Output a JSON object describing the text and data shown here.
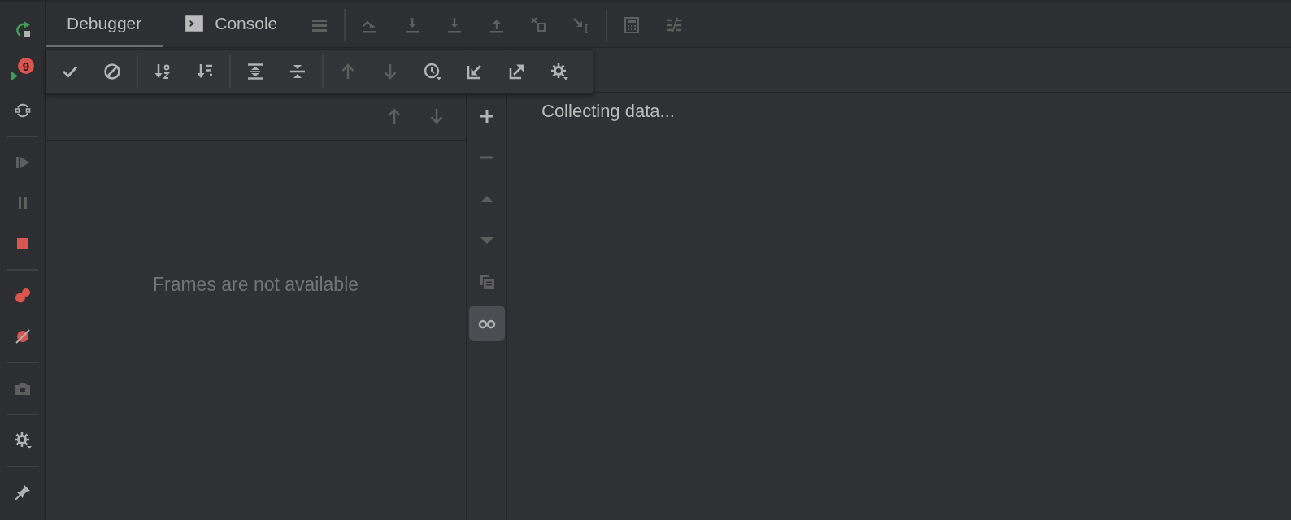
{
  "left_toolbar": [
    [
      {
        "kind": "rerun",
        "disabled": false
      },
      {
        "kind": "resume-error",
        "disabled": false,
        "badge": "9"
      },
      {
        "kind": "restore-layout",
        "disabled": false
      }
    ],
    [
      {
        "kind": "resume",
        "disabled": true
      },
      {
        "kind": "pause",
        "disabled": true
      },
      {
        "kind": "stop",
        "disabled": false
      }
    ],
    [
      {
        "kind": "view-breakpoints",
        "disabled": false
      },
      {
        "kind": "mute-breakpoints",
        "disabled": false
      }
    ],
    [
      {
        "kind": "camera",
        "disabled": true
      }
    ],
    [
      {
        "kind": "settings",
        "disabled": false
      }
    ],
    [
      {
        "kind": "pin",
        "disabled": false
      }
    ]
  ],
  "tabs": [
    {
      "label": "Debugger",
      "selected": true,
      "kind": "plain"
    },
    {
      "label": "Console",
      "selected": false,
      "kind": "console"
    }
  ],
  "tab_toolbar": [
    [
      {
        "kind": "menu-lines",
        "disabled": true
      }
    ],
    [
      {
        "kind": "step-over",
        "disabled": true
      },
      {
        "kind": "step-into",
        "disabled": true
      },
      {
        "kind": "force-step-into",
        "disabled": true
      },
      {
        "kind": "step-out",
        "disabled": true
      },
      {
        "kind": "drop-frame",
        "disabled": true
      },
      {
        "kind": "run-to-cursor",
        "disabled": true
      }
    ],
    [
      {
        "kind": "evaluate",
        "disabled": true
      },
      {
        "kind": "trace",
        "disabled": true
      }
    ]
  ],
  "popup_toolbar": [
    [
      {
        "kind": "check",
        "disabled": false
      },
      {
        "kind": "cancel",
        "disabled": false
      }
    ],
    [
      {
        "kind": "sort-alpha",
        "disabled": false
      },
      {
        "kind": "sort-list",
        "disabled": false
      }
    ],
    [
      {
        "kind": "expand-all",
        "disabled": false
      },
      {
        "kind": "collapse-all",
        "disabled": false
      }
    ],
    [
      {
        "kind": "up",
        "disabled": true
      },
      {
        "kind": "down",
        "disabled": true
      },
      {
        "kind": "clock",
        "disabled": false
      },
      {
        "kind": "import",
        "disabled": false
      },
      {
        "kind": "export",
        "disabled": false
      },
      {
        "kind": "gear",
        "disabled": false
      }
    ]
  ],
  "frames": {
    "header": [
      {
        "kind": "up",
        "disabled": true
      },
      {
        "kind": "down",
        "disabled": true
      }
    ],
    "empty_text": "Frames are not available"
  },
  "gutter": [
    {
      "kind": "plus",
      "disabled": false,
      "selected": false
    },
    {
      "kind": "minus",
      "disabled": true,
      "selected": false
    },
    {
      "kind": "tri-up",
      "disabled": true,
      "selected": false
    },
    {
      "kind": "tri-down",
      "disabled": true,
      "selected": false
    },
    {
      "kind": "copy",
      "disabled": true,
      "selected": false
    },
    {
      "kind": "glasses",
      "disabled": false,
      "selected": true
    }
  ],
  "variables": {
    "status": "Collecting data..."
  }
}
